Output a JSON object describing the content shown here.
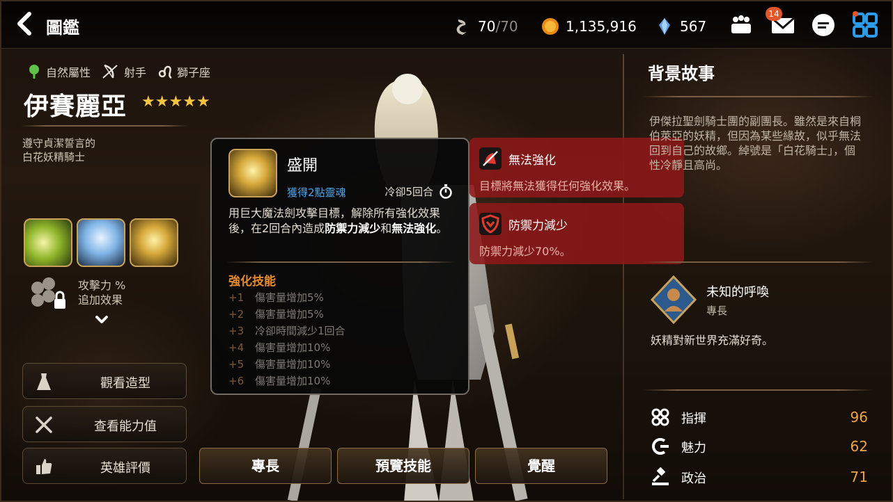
{
  "topbar": {
    "title": "圖鑑",
    "stamina": "70",
    "stamina_max": "/70",
    "gold": "1,135,916",
    "crystals": "567",
    "mail_badge": "14",
    "icons": [
      "back-arrow-icon",
      "stamina-icon",
      "gold-coin-icon",
      "crystal-icon",
      "party-icon",
      "mail-icon",
      "chat-icon",
      "menu-grid-icon"
    ]
  },
  "hero": {
    "attribute": "自然屬性",
    "class": "射手",
    "zodiac": "獅子座",
    "name": "伊賽麗亞",
    "stars": 5,
    "desc_line1": "遵守貞潔誓言的",
    "desc_line2": "白花妖精騎士",
    "attack_line1": "攻擊力 %",
    "attack_line2": "追加效果"
  },
  "side_buttons": [
    "觀看造型",
    "查看能力值",
    "英雄評價"
  ],
  "bottom_buttons": [
    "專長",
    "預覽技能",
    "覺醒"
  ],
  "skill": {
    "name": "盛開",
    "soul": "獲得2點靈魂",
    "cooldown": "冷卻5回合",
    "desc_a": "用巨大魔法劍攻擊目標，解除所有強化效果後，在2回合內造成",
    "desc_b": "防禦力減少",
    "desc_c": "和",
    "desc_d": "無法強化",
    "desc_e": "。",
    "enhance_title": "強化技能",
    "enhance": [
      {
        "n": "+1",
        "text": "傷害量增加5%"
      },
      {
        "n": "+2",
        "text": "傷害量增加5%"
      },
      {
        "n": "+3",
        "text": "冷卻時間減少1回合"
      },
      {
        "n": "+4",
        "text": "傷害量增加10%"
      },
      {
        "n": "+5",
        "text": "傷害量增加10%"
      },
      {
        "n": "+6",
        "text": "傷害量增加10%"
      }
    ]
  },
  "debuffs": [
    {
      "name": "無法強化",
      "desc": "目標將無法獲得任何強化效果。"
    },
    {
      "name": "防禦力減少",
      "desc": "防禦力減少70%。"
    }
  ],
  "background": {
    "title": "背景故事",
    "text": "伊傑拉聖劍騎士團的副團長。雖然是來自桐伯萊亞的妖精，但因為某些緣故，似乎無法回到自己的故鄉。綽號是「白花騎士」，個性冷靜且高尚。"
  },
  "specialty": {
    "name": "未知的呼喚",
    "sub": "專長",
    "desc": "妖精對新世界充滿好奇。"
  },
  "stats": [
    {
      "name": "指揮",
      "value": "96"
    },
    {
      "name": "魅力",
      "value": "62"
    },
    {
      "name": "政治",
      "value": "71"
    }
  ],
  "colors": {
    "accent_gold": "#f5c542",
    "stat_value": "#f0a342",
    "soul_blue": "#4da3e8",
    "enhance_orange": "#e68a2e",
    "debuff_red": "#8c1818",
    "badge_orange": "#e2542a"
  }
}
